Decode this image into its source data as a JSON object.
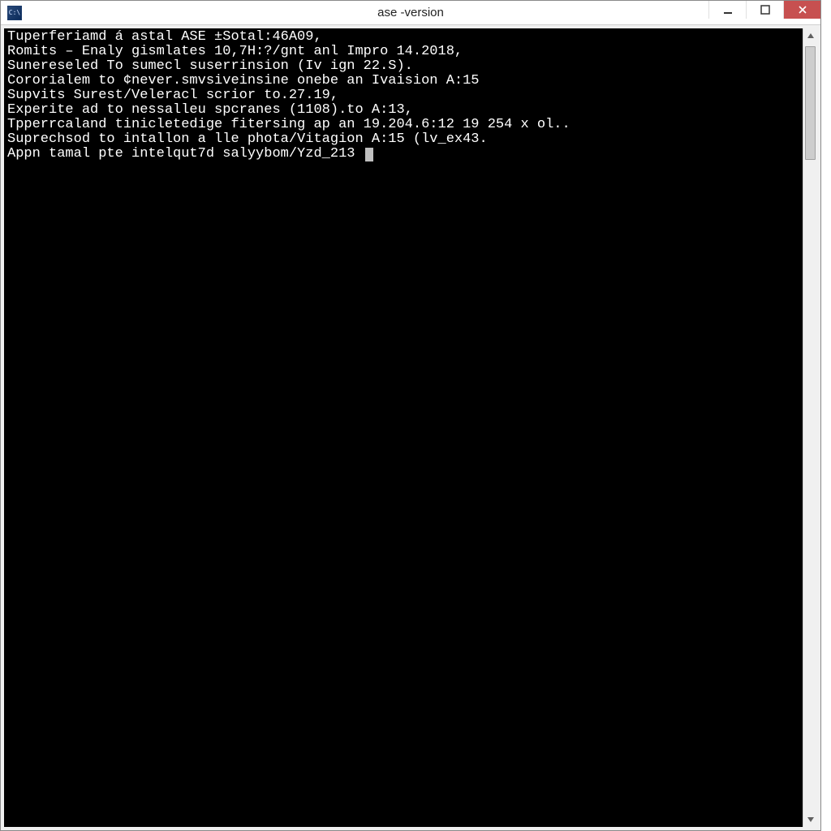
{
  "window": {
    "title": "ase -version"
  },
  "terminal": {
    "lines": [
      "Tuperferiamd á astal ASE ±Sotal:46A09,",
      "Romits – Enaly gismlates 10,7H:?/gnt anl Impro 14.2018,",
      "",
      "Sunereseled To sumecl suserrinsion (Iv ign 22.S).",
      "",
      "Cororialem to ¢never.smvsiveinsine onebe an Ivaision A:15",
      "Supvits Surest/Veleracl scrior to.27.19,",
      "Experite ad to nessalleu spcranes (1108).to A:13,",
      "Tpperrcaland tinicletedige fitersing ap an 19.204.6:12 19 254 x ol..",
      "",
      "Suprechsod to intallon a lle phota/Vitagion A:15 (lv_ex43.",
      "Appn tamal pte intelqut7d salyybom/Yzd_213 "
    ],
    "cursor_after_last": true
  },
  "controls": {
    "minimize_tooltip": "Minimize",
    "maximize_tooltip": "Maximize",
    "close_tooltip": "Close"
  }
}
